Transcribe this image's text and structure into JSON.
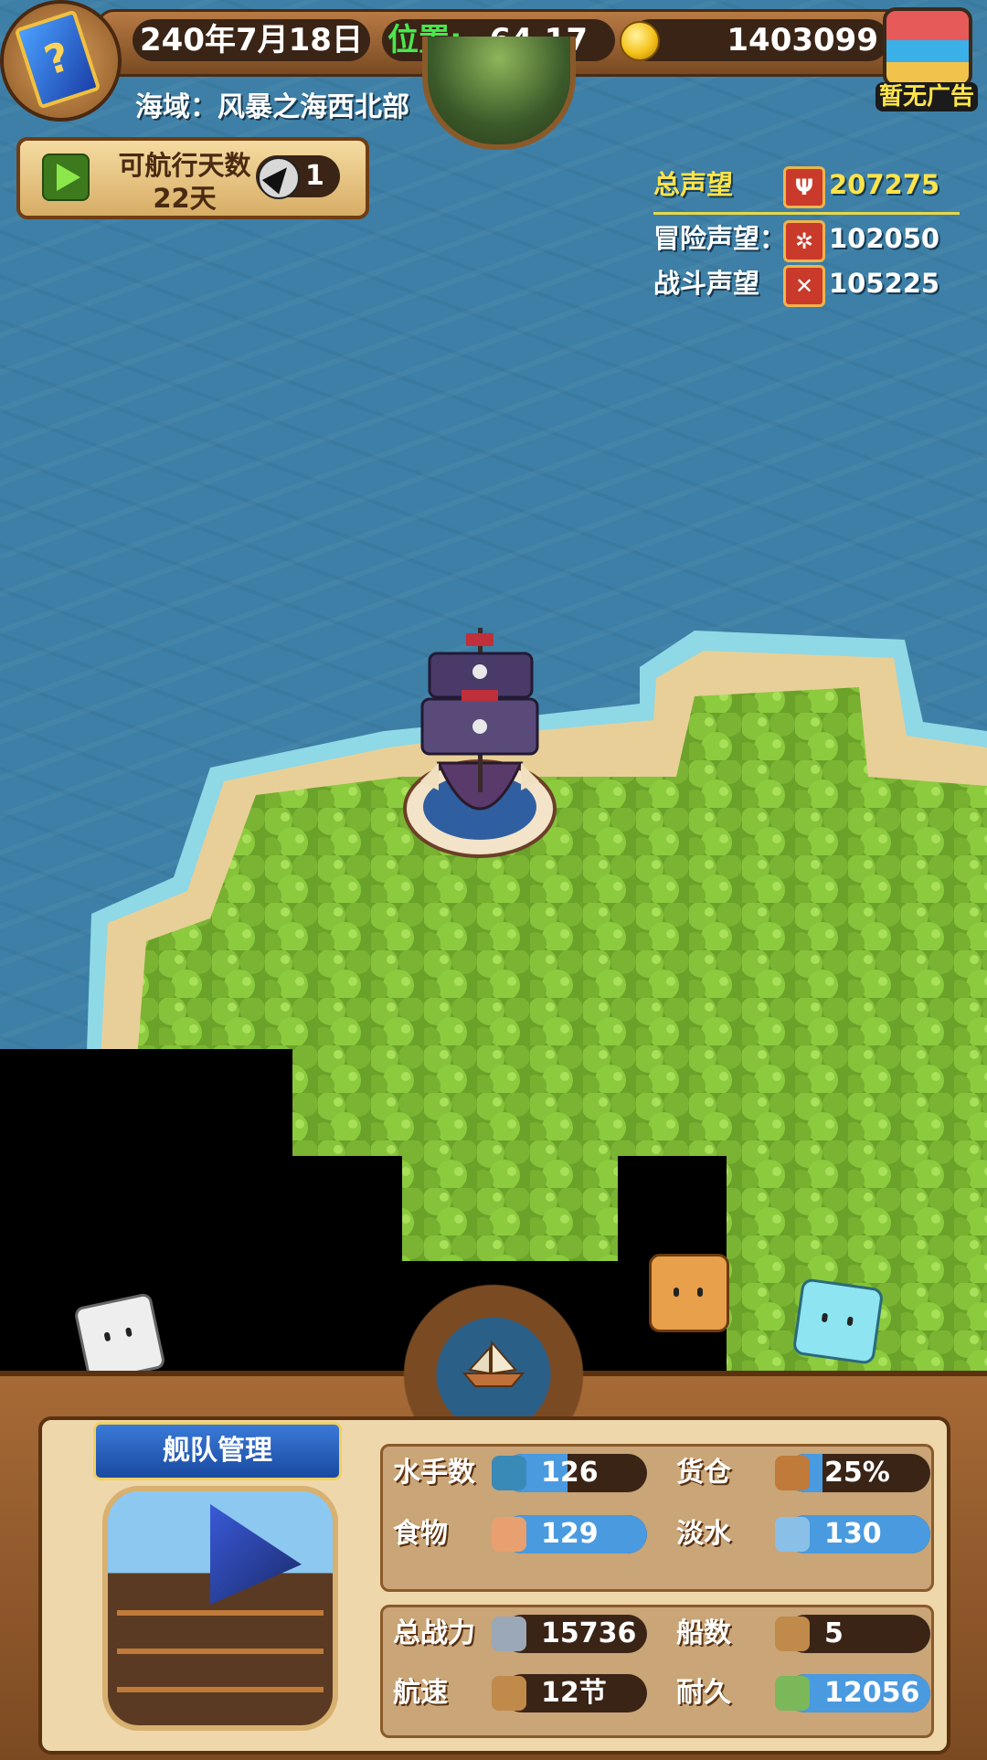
{
  "header": {
    "date": "240年7月18日",
    "position_label": "位置:",
    "position_value": "64,17",
    "gold": "1403099",
    "sea_region": "海域：风暴之海西北部",
    "no_ad_label": "暂无广告"
  },
  "sailing": {
    "days_label": "可航行天数",
    "days_value": "22天",
    "sail_count": "1"
  },
  "reputation": {
    "total_label": "总声望",
    "total_value": "207275",
    "adventure_label": "冒险声望：",
    "adventure_value": "102050",
    "combat_label": "战斗声望",
    "combat_value": "105225"
  },
  "fleet": {
    "title": "舰队管理",
    "stats": [
      {
        "label": "水手数",
        "value": "126",
        "icon": "sailor-icon",
        "fill": 0.45
      },
      {
        "label": "货仓",
        "value": "25%",
        "icon": "crate-icon",
        "fill": 0.25
      },
      {
        "label": "食物",
        "value": "129",
        "icon": "meat-icon",
        "fill": 1.0
      },
      {
        "label": "淡水",
        "value": "130",
        "icon": "water-jug-icon",
        "fill": 1.0
      },
      {
        "label": "总战力",
        "value": "15736",
        "icon": "crossed-swords-skull-icon",
        "fill": 0
      },
      {
        "label": "船数",
        "value": "5",
        "icon": "ship-count-icon",
        "fill": 0
      },
      {
        "label": "航速",
        "value": "12节",
        "icon": "speed-ship-icon",
        "fill": 0
      },
      {
        "label": "耐久",
        "value": "12056",
        "icon": "durability-icon",
        "fill": 1.0
      }
    ]
  },
  "colors": {
    "sea": "#3d7fa6",
    "gold_text": "#ffe34a",
    "green_label": "#48e84e",
    "bar_fill": "#4a9ae0"
  }
}
